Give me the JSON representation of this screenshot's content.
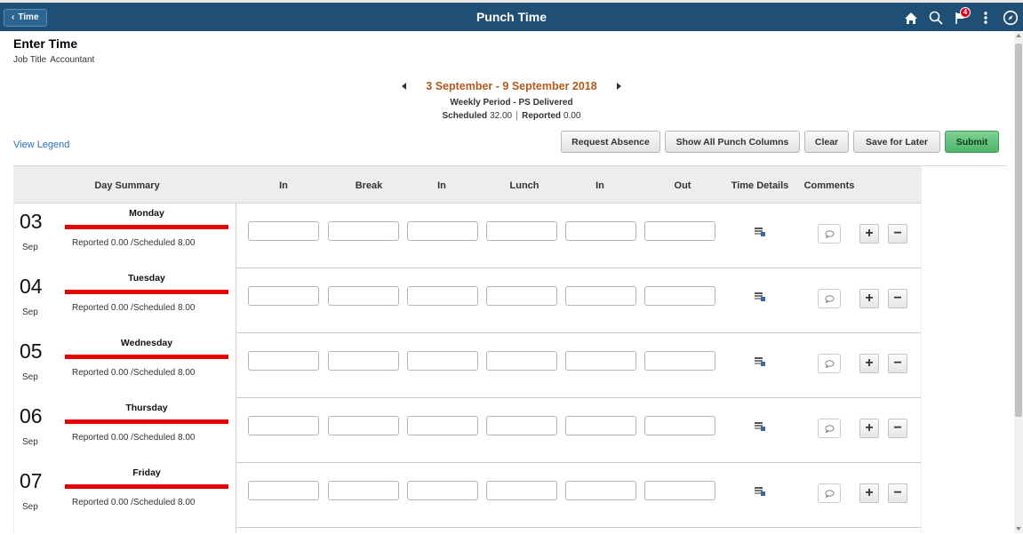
{
  "header": {
    "back_label": "Time",
    "title": "Punch Time",
    "notification_count": "4",
    "icons": [
      "home-icon",
      "search-icon",
      "notifications-flag-icon",
      "actions-menu-icon",
      "navbar-compass-icon"
    ],
    "bg_color": "#1f4f74"
  },
  "page": {
    "heading": "Enter Time",
    "job_title_label": "Job Title",
    "job_title_value": "Accountant"
  },
  "period": {
    "range": "3 September - 9 September 2018",
    "type": "Weekly Period - PS Delivered",
    "scheduled_label": "Scheduled",
    "scheduled_value": "32.00",
    "reported_label": "Reported",
    "reported_value": "0.00",
    "accent_color": "#b05a1e"
  },
  "legend_link": "View Legend",
  "actions": {
    "request_absence": "Request Absence",
    "show_all": "Show All Punch Columns",
    "clear": "Clear",
    "save_for_later": "Save for Later",
    "submit": "Submit"
  },
  "grid": {
    "columns": {
      "day_summary": "Day Summary",
      "in1": "In",
      "break": "Break",
      "in2": "In",
      "lunch": "Lunch",
      "in3": "In",
      "out": "Out",
      "time_details": "Time Details",
      "comments": "Comments"
    },
    "days": [
      {
        "day": "03",
        "month": "Sep",
        "name": "Monday",
        "summary": "Reported 0.00 /Scheduled 8.00"
      },
      {
        "day": "04",
        "month": "Sep",
        "name": "Tuesday",
        "summary": "Reported 0.00 /Scheduled 8.00"
      },
      {
        "day": "05",
        "month": "Sep",
        "name": "Wednesday",
        "summary": "Reported 0.00 /Scheduled 8.00"
      },
      {
        "day": "06",
        "month": "Sep",
        "name": "Thursday",
        "summary": "Reported 0.00 /Scheduled 8.00"
      },
      {
        "day": "07",
        "month": "Sep",
        "name": "Friday",
        "summary": "Reported 0.00 /Scheduled 8.00"
      }
    ],
    "status_bar_color": "#e60000"
  }
}
